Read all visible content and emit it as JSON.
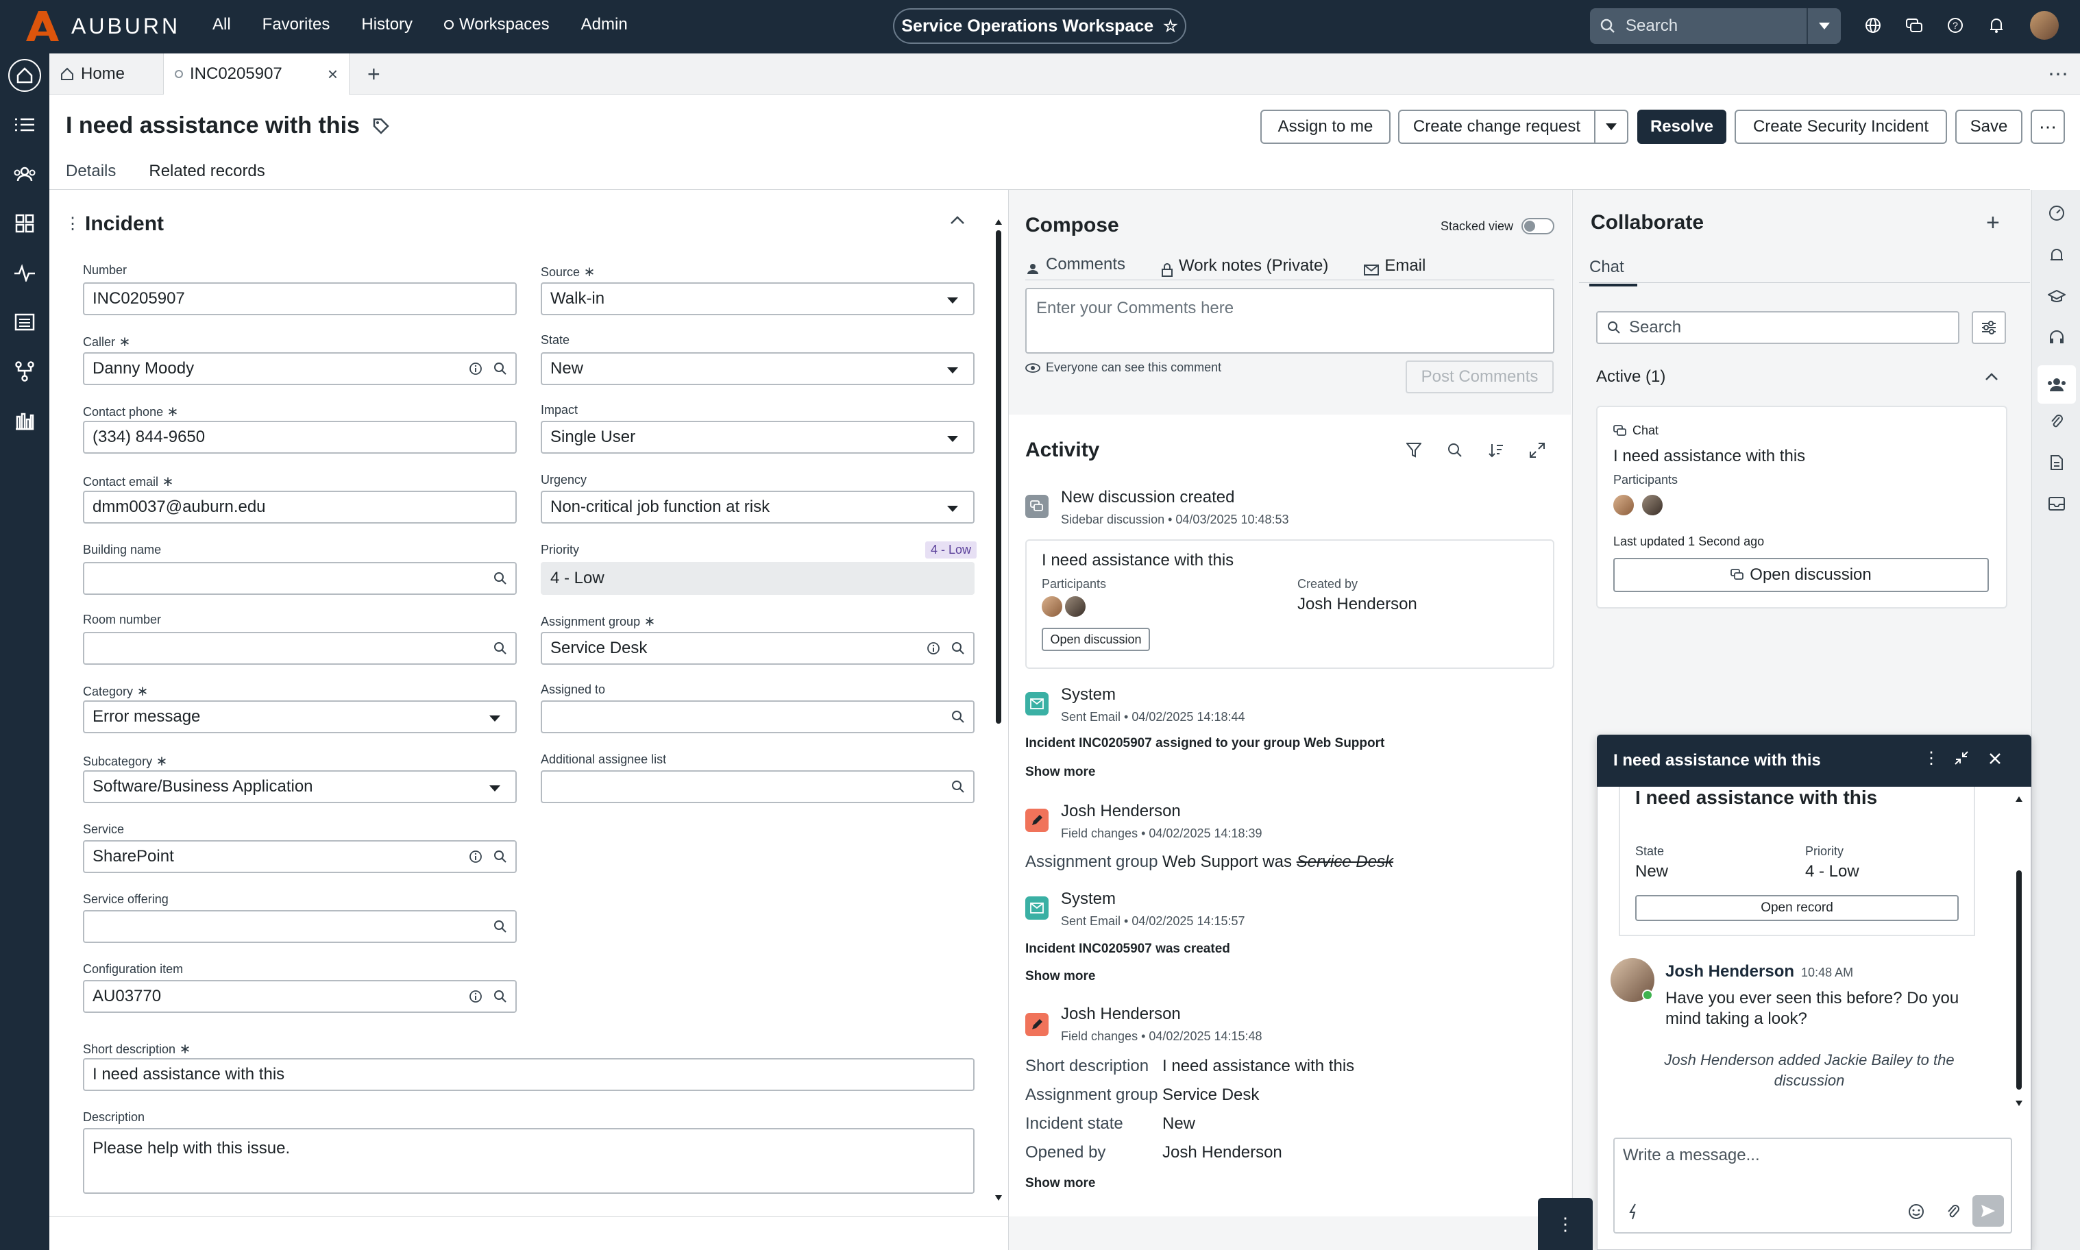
{
  "topnav": {
    "brand": "AUBURN",
    "menu": [
      "All",
      "Favorites",
      "History",
      "Workspaces",
      "Admin"
    ],
    "workspace": "Service Operations Workspace",
    "search_placeholder": "Search"
  },
  "tabs": [
    {
      "label": "Home"
    },
    {
      "label": "INC0205907"
    }
  ],
  "record": {
    "title": "I need assistance with this",
    "buttons": {
      "assign": "Assign to me",
      "change": "Create change request",
      "resolve": "Resolve",
      "security": "Create Security Incident",
      "save": "Save"
    },
    "subtabs": [
      "Details",
      "Related records"
    ]
  },
  "form": {
    "section": "Incident",
    "labels": {
      "number": "Number",
      "source": "Source",
      "caller": "Caller",
      "state": "State",
      "phone": "Contact phone",
      "impact": "Impact",
      "email": "Contact email",
      "urgency": "Urgency",
      "building": "Building name",
      "priority": "Priority",
      "room": "Room number",
      "agroup": "Assignment group",
      "category": "Category",
      "assigned": "Assigned to",
      "subcategory": "Subcategory",
      "addl": "Additional assignee list",
      "service": "Service",
      "offering": "Service offering",
      "ci": "Configuration item",
      "short": "Short description",
      "desc": "Description"
    },
    "values": {
      "number": "INC0205907",
      "source": "Walk-in",
      "caller": "Danny Moody",
      "state": "New",
      "phone": "(334) 844-9650",
      "impact": "Single User",
      "email": "dmm0037@auburn.edu",
      "urgency": "Non-critical job function at risk",
      "building": "",
      "priority": "4 - Low",
      "priority_badge": "4 - Low",
      "room": "",
      "agroup": "Service Desk",
      "category": "Error message",
      "assigned": "",
      "subcategory": "Software/Business Application",
      "addl": "",
      "service": "SharePoint",
      "offering": "",
      "ci": "AU03770",
      "short": "I need assistance with this",
      "desc": "Please help with this issue."
    }
  },
  "compose": {
    "title": "Compose",
    "stacked": "Stacked view",
    "tabs": [
      "Comments",
      "Work notes (Private)",
      "Email"
    ],
    "placeholder": "Enter your Comments here",
    "visibility": "Everyone can see this comment",
    "post": "Post Comments"
  },
  "activity": {
    "title": "Activity",
    "items": [
      {
        "title": "New discussion created",
        "sub": "Sidebar discussion",
        "time": "04/03/2025 10:48:53"
      },
      {
        "title": "System",
        "sub": "Sent Email",
        "time": "04/02/2025 14:18:44",
        "body": "Incident INC0205907 assigned to your group Web Support"
      },
      {
        "title": "Josh Henderson",
        "sub": "Field changes",
        "time": "04/02/2025 14:18:39"
      },
      {
        "title": "System",
        "sub": "Sent Email",
        "time": "04/02/2025 14:15:57",
        "body": "Incident INC0205907 was created"
      },
      {
        "title": "Josh Henderson",
        "sub": "Field changes",
        "time": "04/02/2025 14:15:48"
      }
    ],
    "disc_card": {
      "title": "I need assistance with this",
      "participants": "Participants",
      "created_by_label": "Created by",
      "created_by": "Josh Henderson",
      "open": "Open discussion"
    },
    "change1": {
      "k": "Assignment group",
      "v": "Web Support was",
      "old": "Service Desk"
    },
    "change2": [
      {
        "k": "Short description",
        "v": "I need assistance with this"
      },
      {
        "k": "Assignment group",
        "v": "Service Desk"
      },
      {
        "k": "Incident state",
        "v": "New"
      },
      {
        "k": "Opened by",
        "v": "Josh Henderson"
      }
    ],
    "show_more": "Show more"
  },
  "collab": {
    "title": "Collaborate",
    "tab": "Chat",
    "search": "Search",
    "active": "Active (1)",
    "card": {
      "kind": "Chat",
      "title": "I need assistance with this",
      "participants": "Participants",
      "updated": "Last updated 1 Second ago",
      "open": "Open discussion"
    }
  },
  "popup": {
    "title": "I need assistance with this",
    "card_title": "I need assistance with this",
    "state_label": "State",
    "state": "New",
    "priority_label": "Priority",
    "priority": "4 - Low",
    "open_record": "Open record",
    "msg_author": "Josh Henderson",
    "msg_time": "10:48 AM",
    "msg_text": "Have you ever seen this before? Do you mind taking a look?",
    "system_note": "Josh Henderson added Jackie Bailey to the discussion",
    "input_placeholder": "Write a message..."
  },
  "colors": {
    "nav": "#1c2b3a",
    "accent": "#dd550c",
    "badge": "#e7e0f4"
  }
}
